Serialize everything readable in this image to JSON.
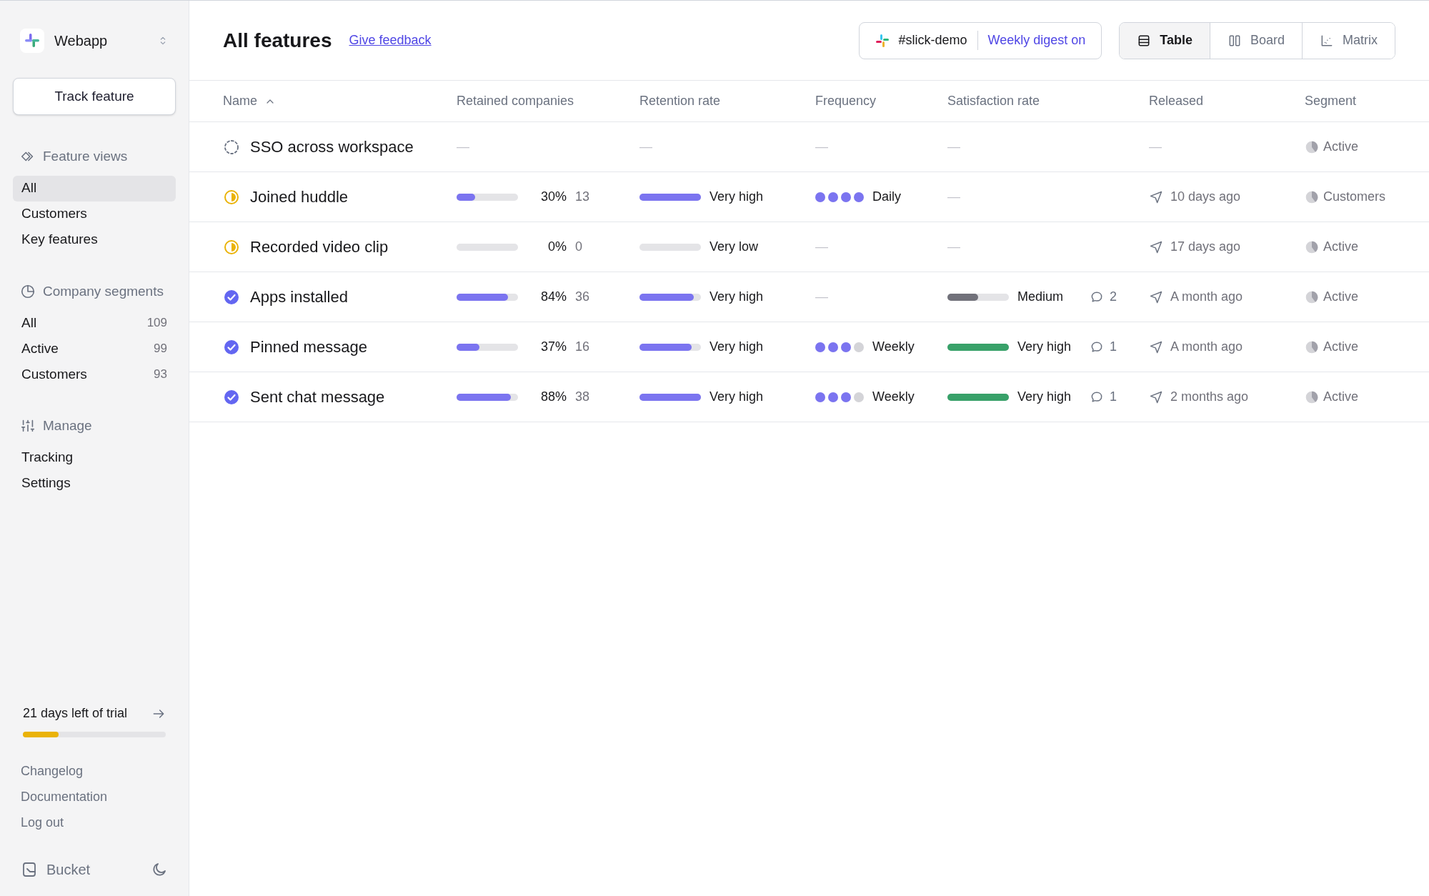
{
  "sidebar": {
    "workspace": "Webapp",
    "track_button": "Track feature",
    "sections": [
      {
        "kind": "views",
        "title": "Feature views",
        "items": [
          {
            "label": "All",
            "selected": true
          },
          {
            "label": "Customers",
            "selected": false
          },
          {
            "label": "Key features",
            "selected": false
          }
        ]
      },
      {
        "kind": "segments",
        "title": "Company segments",
        "items": [
          {
            "label": "All",
            "count": "109",
            "selected": false
          },
          {
            "label": "Active",
            "count": "99",
            "selected": false
          },
          {
            "label": "Customers",
            "count": "93",
            "selected": false
          }
        ]
      },
      {
        "kind": "manage",
        "title": "Manage",
        "items": [
          {
            "label": "Tracking",
            "selected": false
          },
          {
            "label": "Settings",
            "selected": false
          }
        ]
      }
    ],
    "trial": {
      "label": "21 days left of trial",
      "level": 0.25
    },
    "links": [
      "Changelog",
      "Documentation",
      "Log out"
    ],
    "brand": "Bucket"
  },
  "header": {
    "title": "All features",
    "feedback_link": "Give feedback",
    "channel": "#slick-demo",
    "digest": "Weekly digest on",
    "views": [
      {
        "label": "Table",
        "kind": "table",
        "selected": true
      },
      {
        "label": "Board",
        "kind": "board",
        "selected": false
      },
      {
        "label": "Matrix",
        "kind": "matrix",
        "selected": false
      }
    ]
  },
  "table": {
    "columns": [
      "Name",
      "Retained companies",
      "Retention rate",
      "Frequency",
      "Satisfaction rate",
      "Released",
      "Segment"
    ],
    "rows": [
      {
        "kind": "planned",
        "name": "SSO across workspace",
        "retained": "—",
        "retention": "—",
        "frequency": "—",
        "satisfaction": "—",
        "released": "—",
        "segment": "Active"
      },
      {
        "kind": "in_progress",
        "name": "Joined huddle",
        "retained": {
          "level": 0.3,
          "percent": "30%",
          "count": "13"
        },
        "retention": {
          "level": 1,
          "label": "Very high"
        },
        "frequency": {
          "stars": 4,
          "label": "Daily"
        },
        "satisfaction": "—",
        "released": "10 days ago",
        "segment": "Customers"
      },
      {
        "kind": "in_progress",
        "name": "Recorded video clip",
        "retained": {
          "level": 0,
          "percent": "0%",
          "count": "0"
        },
        "retention": {
          "level": 0,
          "label": "Very low"
        },
        "frequency": "—",
        "satisfaction": "—",
        "released": "17 days ago",
        "segment": "Active"
      },
      {
        "kind": "done",
        "name": "Apps installed",
        "retained": {
          "level": 0.84,
          "percent": "84%",
          "count": "36"
        },
        "retention": {
          "level": 0.88,
          "label": "Very high"
        },
        "frequency": "—",
        "satisfaction": {
          "level": 0.5,
          "color": "#71717a",
          "label": "Medium",
          "comments": "2"
        },
        "released": "A month ago",
        "segment": "Active"
      },
      {
        "kind": "done",
        "name": "Pinned message",
        "retained": {
          "level": 0.37,
          "percent": "37%",
          "count": "16"
        },
        "retention": {
          "level": 0.85,
          "label": "Very high"
        },
        "frequency": {
          "stars": 3,
          "label": "Weekly"
        },
        "satisfaction": {
          "level": 1,
          "color": "#38a169",
          "label": "Very high",
          "comments": "1"
        },
        "released": "A month ago",
        "segment": "Active"
      },
      {
        "kind": "done",
        "name": "Sent chat message",
        "retained": {
          "level": 0.88,
          "percent": "88%",
          "count": "38"
        },
        "retention": {
          "level": 1,
          "label": "Very high"
        },
        "frequency": {
          "stars": 3,
          "label": "Weekly"
        },
        "satisfaction": {
          "level": 1,
          "color": "#38a169",
          "label": "Very high",
          "comments": "1"
        },
        "released": "2 months ago",
        "segment": "Active"
      }
    ]
  }
}
